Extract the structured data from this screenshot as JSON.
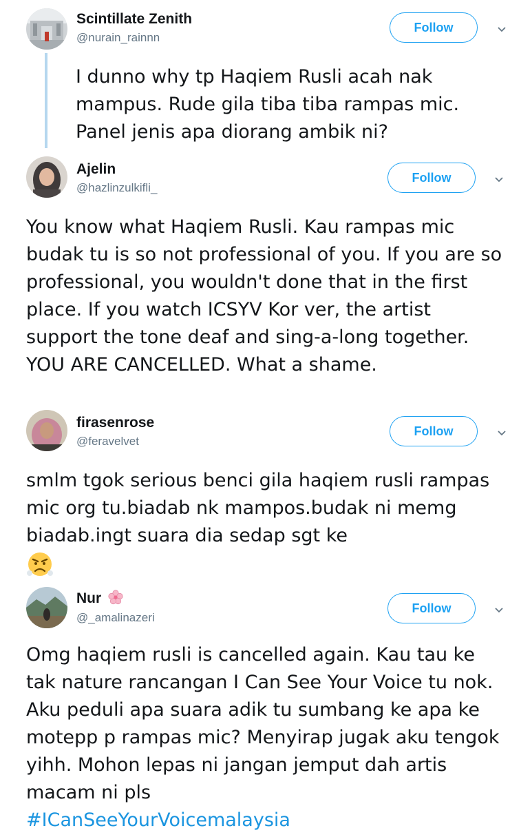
{
  "tweets": [
    {
      "name": "Scintillate Zenith",
      "handle": "@nurain_rainnn",
      "follow_label": "Follow",
      "text": "I dunno why tp Haqiem Rusli acah nak mampus. Rude gila tiba tiba rampas mic. Panel jenis apa diorang ambik ni?"
    },
    {
      "name": "Ajelin",
      "handle": "@hazlinzulkifli_",
      "follow_label": "Follow",
      "text": "You know what Haqiem Rusli. Kau rampas mic budak tu is so not professional of you. If you are so professional, you wouldn't done that in the first place. If you watch ICSYV Kor ver, the artist support the  tone deaf and sing-a-long together. YOU ARE CANCELLED. What a shame."
    },
    {
      "name": "firasenrose",
      "handle": "@feravelvet",
      "follow_label": "Follow",
      "text": "smlm tgok serious benci gila haqiem rusli rampas mic org tu.biadab nk mampos.budak ni memg biadab.ingt suara dia sedap sgt ke",
      "emoji": "angry-face-emoji"
    },
    {
      "name": "Nur",
      "name_emoji": "cherry-blossom-emoji",
      "handle": "@_amalinazeri",
      "follow_label": "Follow",
      "text": "Omg haqiem rusli is cancelled again. Kau tau ke tak nature rancangan I Can See Your Voice tu nok. Aku peduli apa suara adik tu sumbang ke apa ke motepp p rampas mic? Menyirap jugak aku tengok yihh. Mohon lepas ni jangan jemput dah artis macam ni pls",
      "hashtag": "#ICanSeeYourVoicemalaysia"
    }
  ],
  "colors": {
    "accent": "#1da1f2",
    "hashtag": "#1b95e0",
    "secondary_text": "#657786",
    "thread_line": "#b5d7ef"
  }
}
